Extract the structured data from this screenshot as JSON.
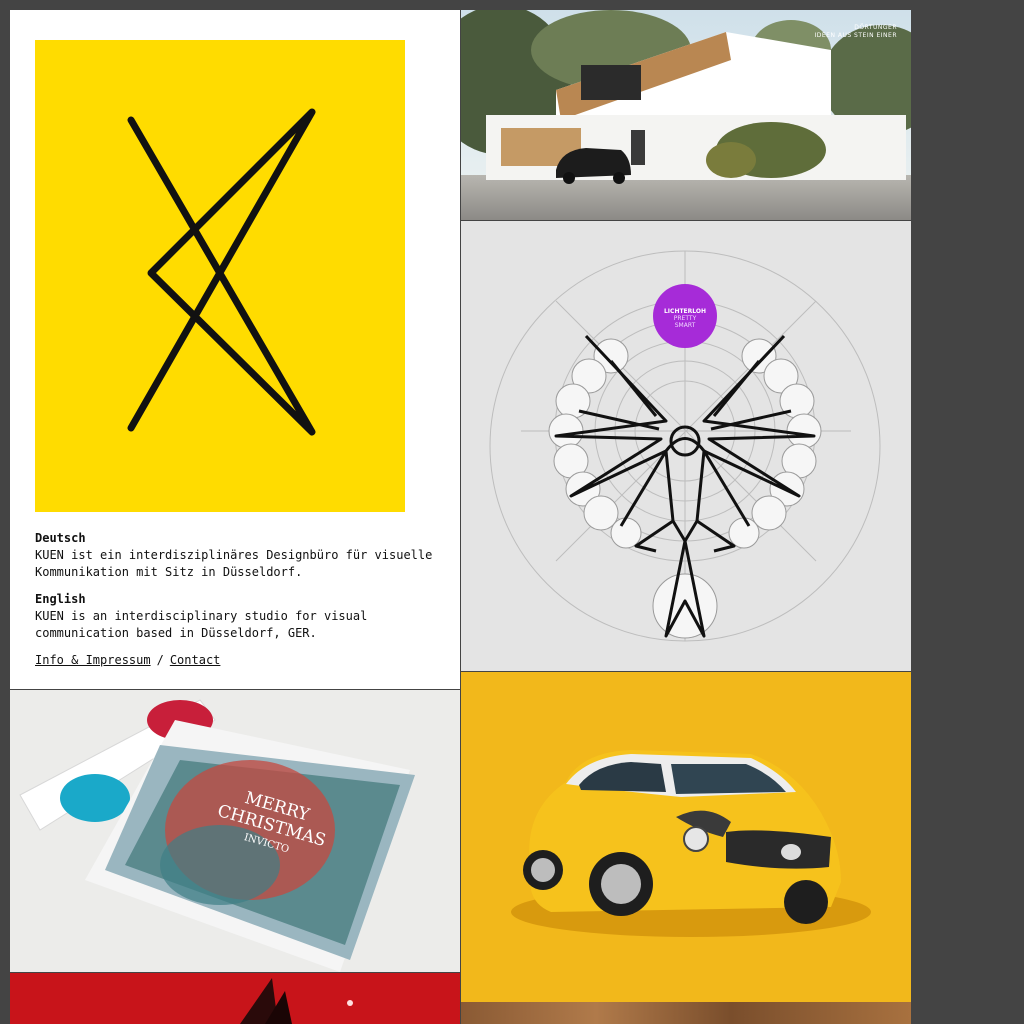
{
  "intro": {
    "deutsch_title": "Deutsch",
    "deutsch_text": "KUEN ist ein interdisziplinäres Designbüro für visuelle Kommunikation mit Sitz in Düsseldorf.",
    "english_title": "English",
    "english_text": "KUEN is an interdisciplinary studio for visual communication based in Düsseldorf, GER.",
    "link_info": "Info & Impressum",
    "link_separator": "/",
    "link_contact": "Contact"
  },
  "house": {
    "caption_line1": "DÖRTUNGER",
    "caption_line2": "IDEEN AUS STEIN EINER"
  },
  "eagle": {
    "badge_line1": "LICHTERLOH",
    "badge_line2": "PRETTY",
    "badge_line3": "SMART"
  },
  "xmas": {
    "card_line1": "MERRY",
    "card_line2": "CHRISTMAS",
    "card_line3": "INVICTO"
  },
  "colors": {
    "page_bg": "#444444",
    "logo_yellow": "#ffdc00",
    "eagle_badge": "#a62bd8",
    "car_bg": "#f2b81b"
  }
}
